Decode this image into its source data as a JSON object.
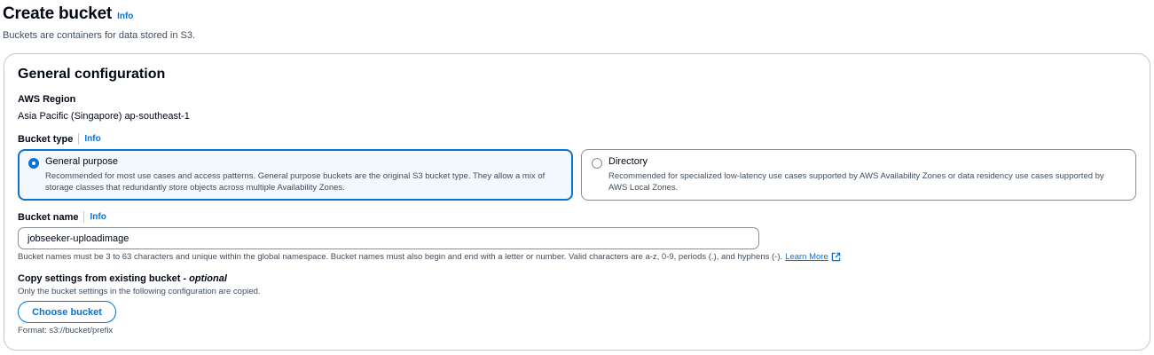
{
  "header": {
    "title": "Create bucket",
    "info": "Info",
    "description": "Buckets are containers for data stored in S3."
  },
  "general": {
    "title": "General configuration",
    "region_label": "AWS Region",
    "region_value": "Asia Pacific (Singapore) ap-southeast-1",
    "bucket_type_label": "Bucket type",
    "bucket_type_info": "Info",
    "bucket_types": [
      {
        "title": "General purpose",
        "description": "Recommended for most use cases and access patterns. General purpose buckets are the original S3 bucket type. They allow a mix of storage classes that redundantly store objects across multiple Availability Zones.",
        "selected": true
      },
      {
        "title": "Directory",
        "description": "Recommended for specialized low-latency use cases supported by AWS Availability Zones or data residency use cases supported by AWS Local Zones.",
        "selected": false
      }
    ],
    "bucket_name_label": "Bucket name",
    "bucket_name_info": "Info",
    "bucket_name_value": "jobseeker-uploadimage",
    "bucket_name_hint": "Bucket names must be 3 to 63 characters and unique within the global namespace. Bucket names must also begin and end with a letter or number. Valid characters are a-z, 0-9, periods (.), and hyphens (-).",
    "learn_more": "Learn More",
    "copy_label": "Copy settings from existing bucket - ",
    "copy_optional": "optional",
    "copy_description": "Only the bucket settings in the following configuration are copied.",
    "choose_bucket": "Choose bucket",
    "format_hint": "Format: s3://bucket/prefix"
  },
  "colors": {
    "accent": "#0972d3",
    "selected_bg": "#f2f8fd",
    "border": "#8c8c94",
    "secondary_text": "#414d5c"
  },
  "icons": {
    "external_link": "external-link-icon"
  }
}
